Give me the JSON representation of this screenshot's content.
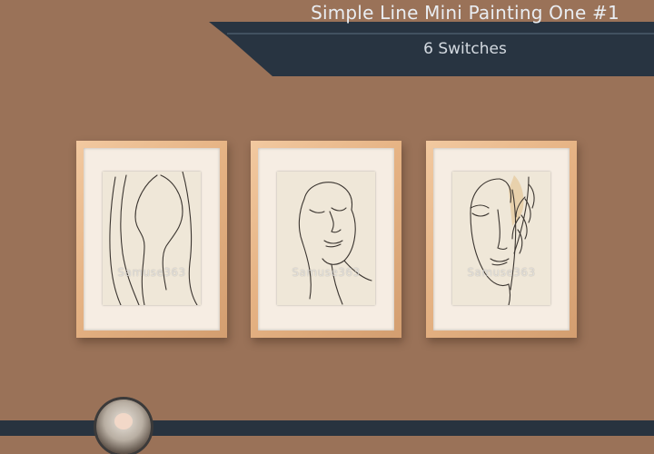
{
  "banner": {
    "title": "Simple Line Mini Painting One #1",
    "subtitle": "6 Switches",
    "colors": {
      "banner": "#283441",
      "accent_line": "#5b6e80",
      "background": "#9a7258"
    }
  },
  "paintings": [
    {
      "subject": "abstract line art figure",
      "watermark": "Samuse363"
    },
    {
      "subject": "line art woman face with closed eyes",
      "watermark": "Samuse363"
    },
    {
      "subject": "line art face with leaf",
      "watermark": "Samuse363"
    }
  ],
  "footer": {
    "avatar": "creator-avatar"
  },
  "colors": {
    "frame": "#e6b384",
    "mat": "#f6ede3",
    "paper": "#efe7d8",
    "line": "#3b3530"
  }
}
